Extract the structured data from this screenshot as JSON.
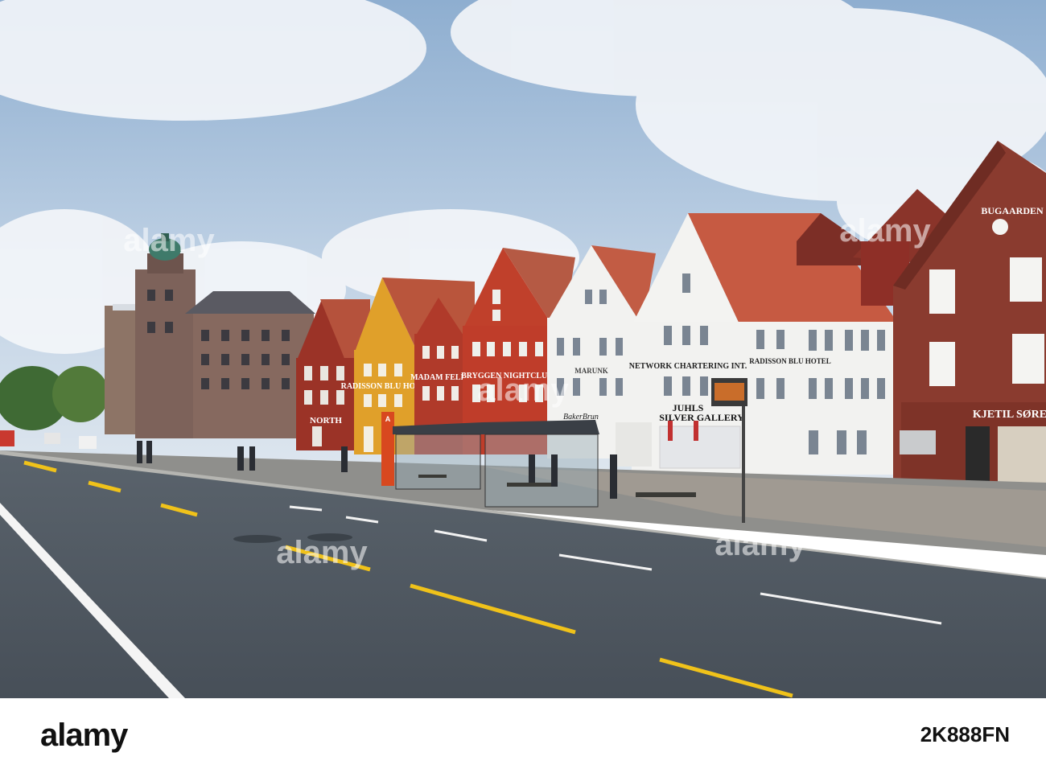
{
  "photo": {
    "signs": {
      "bugaarden": "BUGAARDEN",
      "kjetil": "KJETIL SØRE",
      "radisson_right": "RADISSON BLU HOTEL",
      "network": "NETWORK CHARTERING INT.",
      "juhls_1": "JUHLS",
      "juhls_2": "SILVER GALLERY",
      "marunk": "MARUNK",
      "baker": "BakerBrun",
      "bryggen": "BRYGGEN NIGHTCLUB",
      "madam": "MADAM FELLE",
      "radisson_yellow": "RADISSON BLU HOTEL",
      "north": "NORTH",
      "stop_letter": "A"
    },
    "watermarks": [
      "alamy",
      "alamy",
      "alamy",
      "alamy",
      "alamy"
    ]
  },
  "footer": {
    "logo": "alamy",
    "image_id": "2K888FN"
  },
  "colors": {
    "sky": "#9fb9d6",
    "road": "#4d5660",
    "red_house": "#a63a2a",
    "yellow_house": "#e3a12a",
    "white_house": "#f2f2f0",
    "brown_house": "#7f3a2e",
    "lane_line": "#f0c21a"
  }
}
